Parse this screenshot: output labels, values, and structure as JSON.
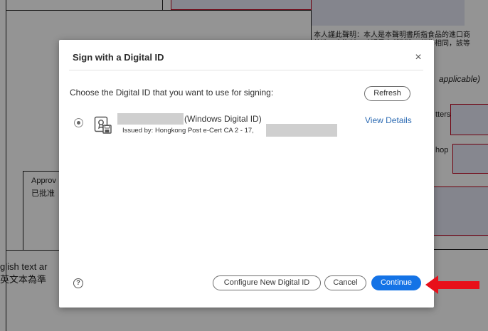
{
  "document": {
    "chinese_statement_line1": "本人謹此聲明：本人是本聲明書所指食品的進口商",
    "chinese_statement_line2": "的進口商資料，確認是次所列進口報告相同，該等",
    "applicable_hint": "applicable)",
    "letters_fragment": "tters",
    "chop_fragment": "hop",
    "approved_en": "Approv",
    "approved_zh": "已批准",
    "english_text_fragment": "glish text ar",
    "chinese_text_fragment": "英文本為準"
  },
  "dialog": {
    "title": "Sign with a Digital ID",
    "close_symbol": "×",
    "instruction": "Choose the Digital ID that you want to use for signing:",
    "refresh_label": "Refresh",
    "digital_id": {
      "type_label": "(Windows Digital ID)",
      "issued_by": "Issued by: Hongkong Post e-Cert CA 2 - 17,",
      "view_details_label": "View Details",
      "selected": true
    },
    "help_symbol": "?",
    "configure_label": "Configure New Digital ID",
    "cancel_label": "Cancel",
    "continue_label": "Continue"
  },
  "colors": {
    "primary_button": "#1473e6",
    "link": "#2d6bb3",
    "annotation_arrow": "#e8101a",
    "form_border_red": "#c0001a"
  },
  "icons": {
    "close": "close-icon",
    "digital_id": "digital-id-certificate-icon",
    "help": "help-icon",
    "annotation": "red-arrow-icon"
  }
}
